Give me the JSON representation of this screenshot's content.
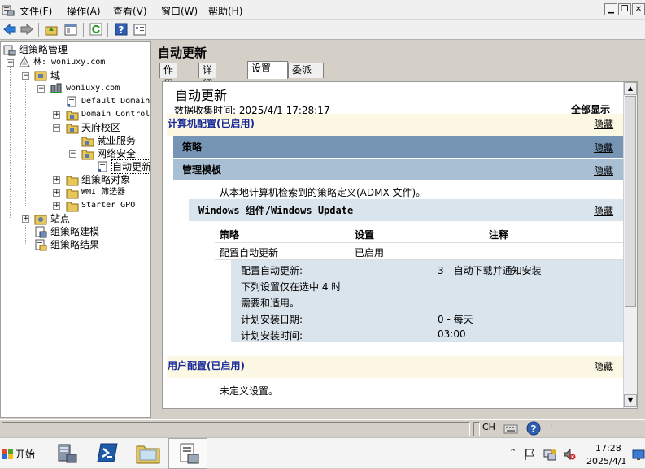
{
  "menubar": {
    "items": [
      "文件(F)",
      "操作(A)",
      "查看(V)",
      "窗口(W)",
      "帮助(H)"
    ]
  },
  "tree": {
    "root": "组策略管理",
    "forest": "林: woniuxy.com",
    "domains": "域",
    "domain": "woniuxy.com",
    "default_policy": "Default Domain",
    "dc": "Domain Control",
    "ou1": "天府校区",
    "ou1_child": "就业服务",
    "ou2": "网络安全",
    "gpo": "自动更新",
    "gpo_objects": "组策略对象",
    "wmi": "WMI 筛选器",
    "starter": "Starter GPO",
    "sites": "站点",
    "modeling": "组策略建模",
    "results": "组策略结果"
  },
  "right": {
    "title": "自动更新",
    "tabs": [
      "作用域",
      "详细信息",
      "设置",
      "委派"
    ],
    "report": {
      "heading": "自动更新",
      "collected": "数据收集时间: 2025/4/1 17:28:17",
      "show_all": "全部显示",
      "computer_config": "计算机配置(已启用)",
      "hide": "隐藏",
      "policies": "策略",
      "admin_templates": "管理模板",
      "admx_note": "从本地计算机检索到的策略定义(ADMX 文件)。",
      "wu_section": "Windows 组件/Windows Update",
      "col_policy": "策略",
      "col_setting": "设置",
      "col_comment": "注释",
      "row_policy": "配置自动更新",
      "row_setting": "已启用",
      "detail_label1": "配置自动更新:",
      "detail_value1": "3 - 自动下载并通知安装",
      "detail_text2": "下列设置仅在选中 4 时",
      "detail_text3": "需要和适用。",
      "detail_label4": "计划安装日期:",
      "detail_value4": "0 - 每天",
      "detail_label5": "计划安装时间:",
      "detail_value5": "03:00",
      "user_config": "用户配置(已启用)",
      "undefined": "未定义设置。"
    }
  },
  "status": {
    "lang": "CH"
  },
  "taskbar": {
    "start": "开始",
    "time": "17:28",
    "date": "2025/4/1"
  }
}
